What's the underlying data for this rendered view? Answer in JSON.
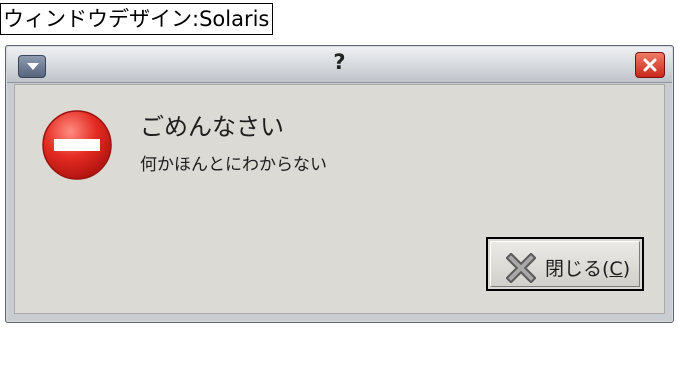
{
  "caption": "ウィンドウデザイン:Solaris",
  "window": {
    "title": "?"
  },
  "dialog": {
    "heading": "ごめんなさい",
    "message": "何かほんとにわからない",
    "close_button": {
      "prefix": "閉じる(",
      "mnemonic": "C",
      "suffix": ")"
    }
  },
  "icons": {
    "window_menu": "chevron-down-icon",
    "window_close": "close-icon",
    "error": "no-entry-icon",
    "button": "close-x-icon"
  },
  "colors": {
    "error_red": "#e02a22",
    "close_button": "#d23a2a",
    "dialog_bg": "#dcdad5"
  }
}
